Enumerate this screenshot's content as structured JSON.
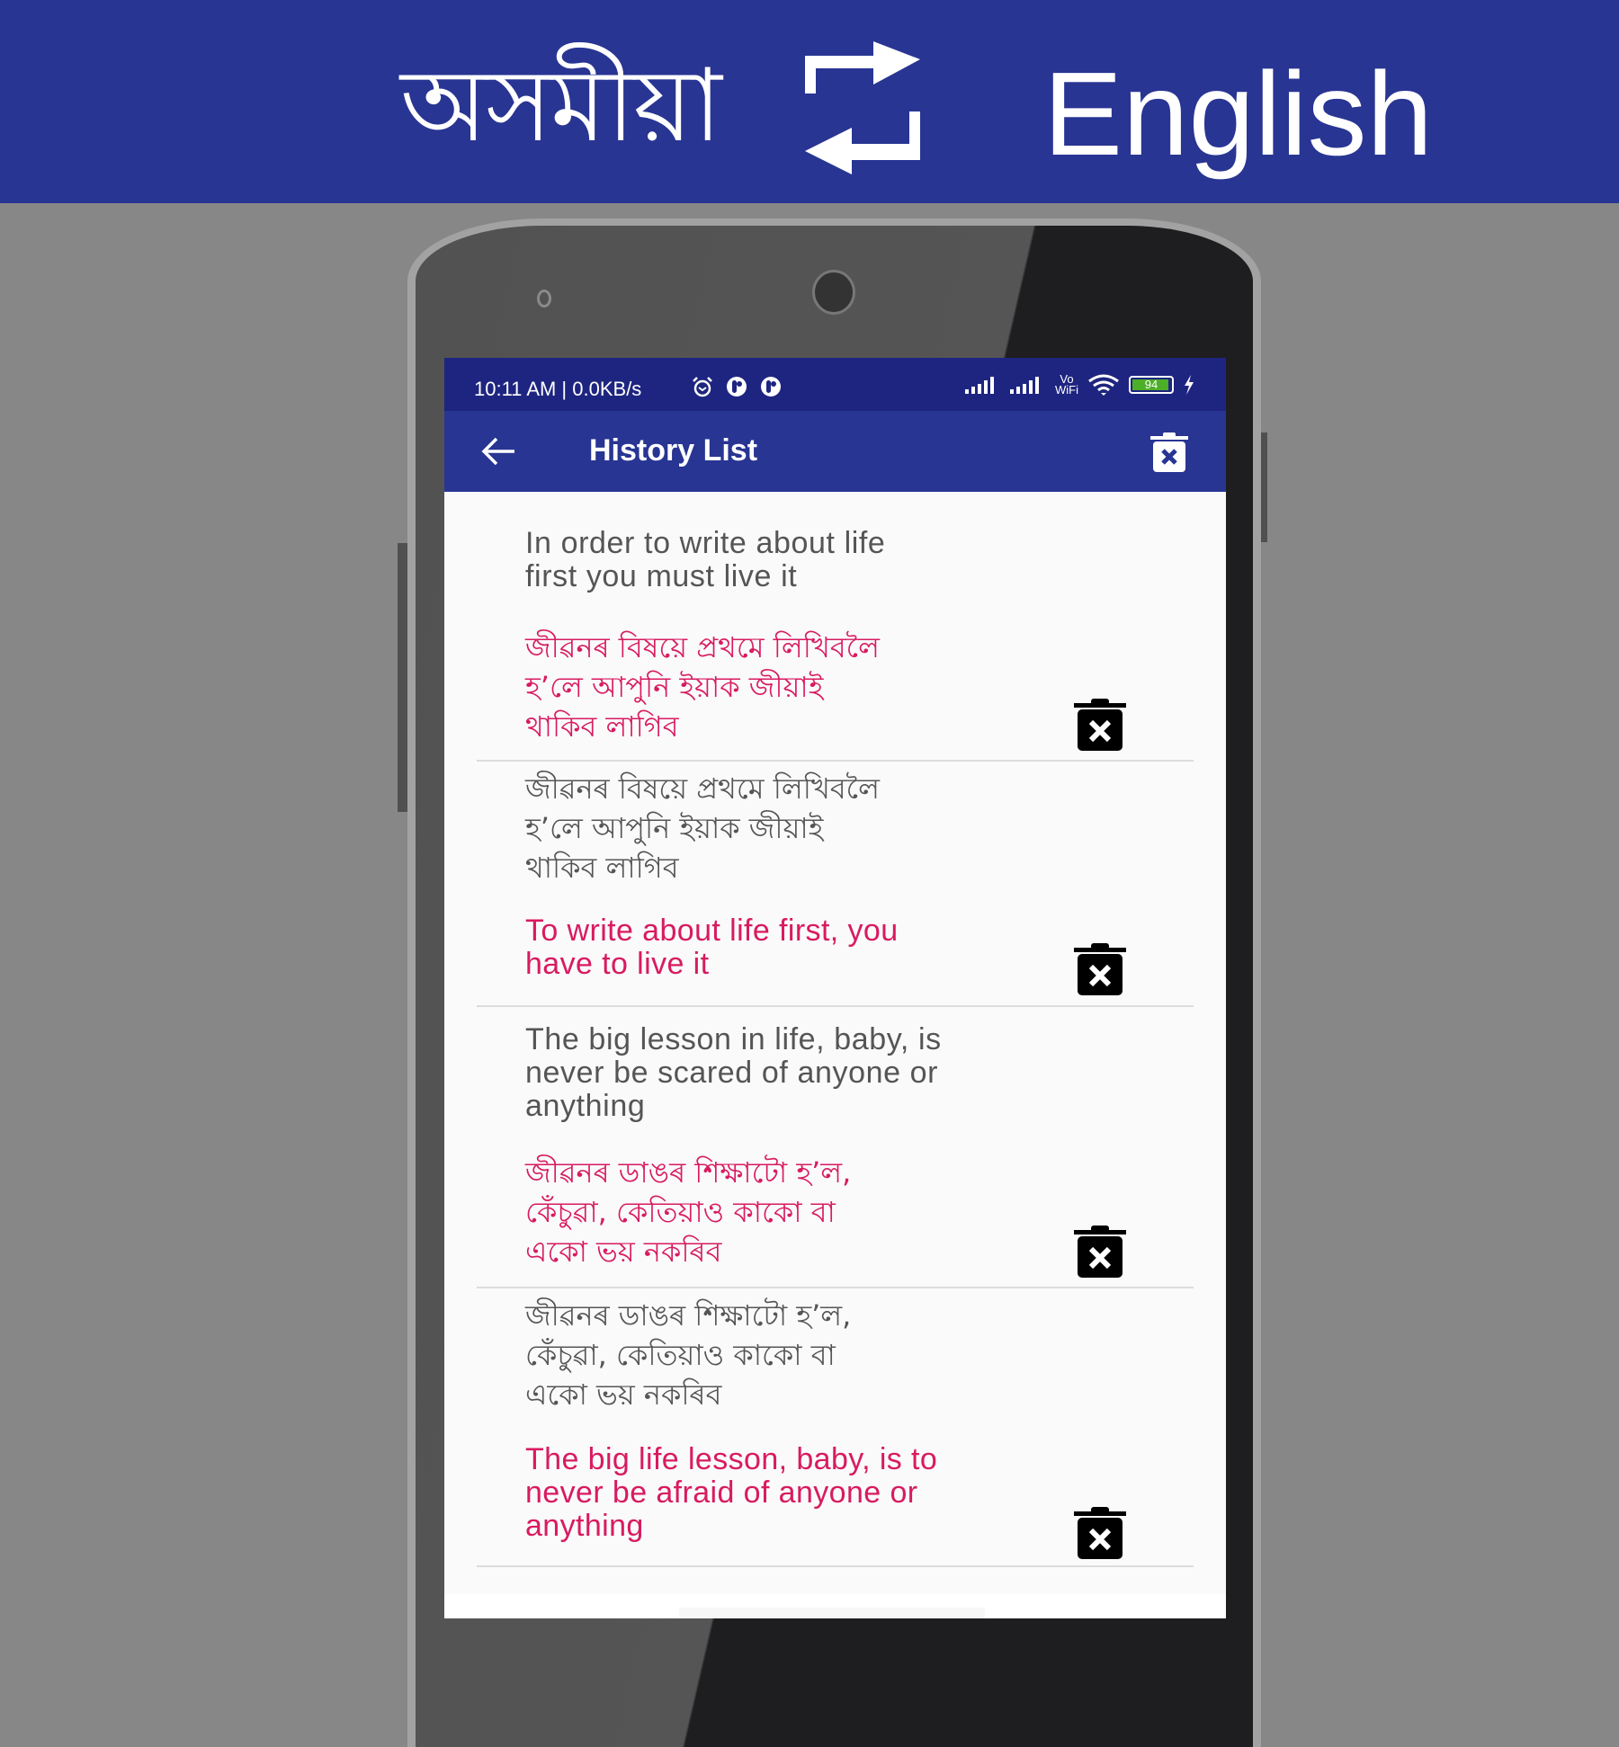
{
  "banner": {
    "source_language": "অসমীয়া",
    "target_language": "English",
    "swap_icon": "swap-arrows-icon"
  },
  "statusbar": {
    "time": "10:11 AM | 0.0KB/s",
    "icons_left": [
      "alarm-icon",
      "app-notification-icon",
      "app-notification-icon"
    ],
    "icons_right": [
      "signal-icon",
      "signal-icon",
      "vowifi-icon",
      "wifi-icon",
      "battery-icon",
      "charging-icon"
    ],
    "vowifi_label_top": "Vo",
    "vowifi_label_bottom": "WiFi",
    "battery_level": "94"
  },
  "appbar": {
    "title": "History List",
    "back_icon": "arrow-back-icon",
    "clear_all_icon": "delete-all-icon"
  },
  "colors": {
    "banner": "#293593",
    "statusbar": "#1e2580",
    "appbar": "#283593",
    "source_text": "#555555",
    "translation_text": "#d81b60",
    "background": "#878787"
  },
  "history": [
    {
      "source": "In order to write about life first you must live it",
      "source_lines": [
        "In order to write about life",
        "first you must live it"
      ],
      "translation_lines": [
        "জীৱনৰ বিষয়ে প্ৰথমে লিখিবলৈ",
        "হ’লে আপুনি ইয়াক জীয়াই",
        "থাকিব লাগিব"
      ]
    },
    {
      "source_lines": [
        "জীৱনৰ বিষয়ে প্ৰথমে লিখিবলৈ",
        "হ’লে আপুনি ইয়াক জীয়াই",
        "থাকিব লাগিব"
      ],
      "translation_lines": [
        "To write about life first, you",
        "have to live it"
      ]
    },
    {
      "source_lines": [
        "The big lesson in life, baby, is",
        "never be scared of anyone or",
        "anything"
      ],
      "translation_lines": [
        "জীৱনৰ ডাঙৰ শিক্ষাটো হ’ল,",
        "কেঁচুৱা, কেতিয়াও কাকো বা",
        "একো ভয় নকৰিব"
      ]
    },
    {
      "source_lines": [
        "জীৱনৰ ডাঙৰ শিক্ষাটো হ’ল,",
        "কেঁচুৱা, কেতিয়াও কাকো বা",
        "একো ভয় নকৰিব"
      ],
      "translation_lines": [
        "The big life lesson, baby, is to",
        "never be afraid of anyone or",
        "anything"
      ]
    }
  ]
}
